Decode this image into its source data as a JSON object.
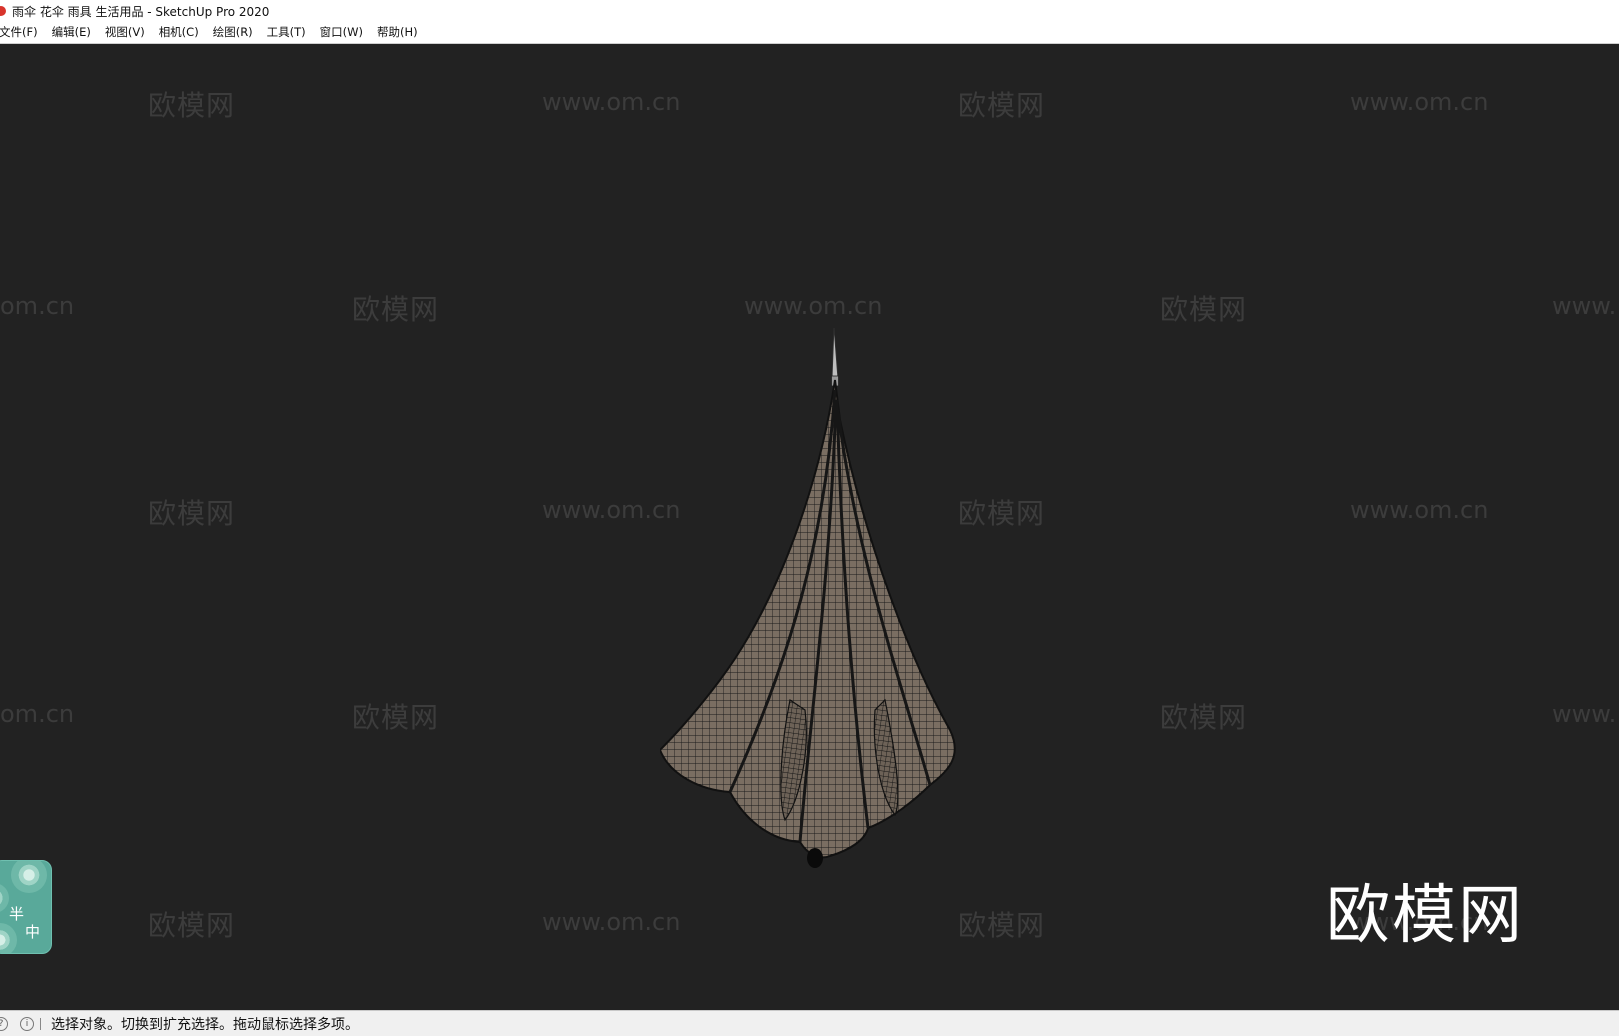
{
  "window": {
    "title": "雨伞 花伞 雨具 生活用品 - SketchUp Pro 2020"
  },
  "menu": {
    "items": [
      "文件(F)",
      "编辑(E)",
      "视图(V)",
      "相机(C)",
      "绘图(R)",
      "工具(T)",
      "窗口(W)",
      "帮助(H)"
    ]
  },
  "viewport": {
    "watermark_logo": "欧模网",
    "watermark_url": "www.om.cn",
    "watermark_url_partial": "om.cn",
    "watermark_url_partial_right": "www.",
    "brand_logo": "欧模网"
  },
  "sticker": {
    "char1": "半",
    "char2": "中"
  },
  "status": {
    "message": "选择对象。切换到扩充选择。拖动鼠标选择多项。"
  },
  "colors": {
    "background": "#222222",
    "umbrella_fill": "#7a6e62",
    "mesh_line": "#1a1a1a",
    "sticker": "#59a99a"
  }
}
